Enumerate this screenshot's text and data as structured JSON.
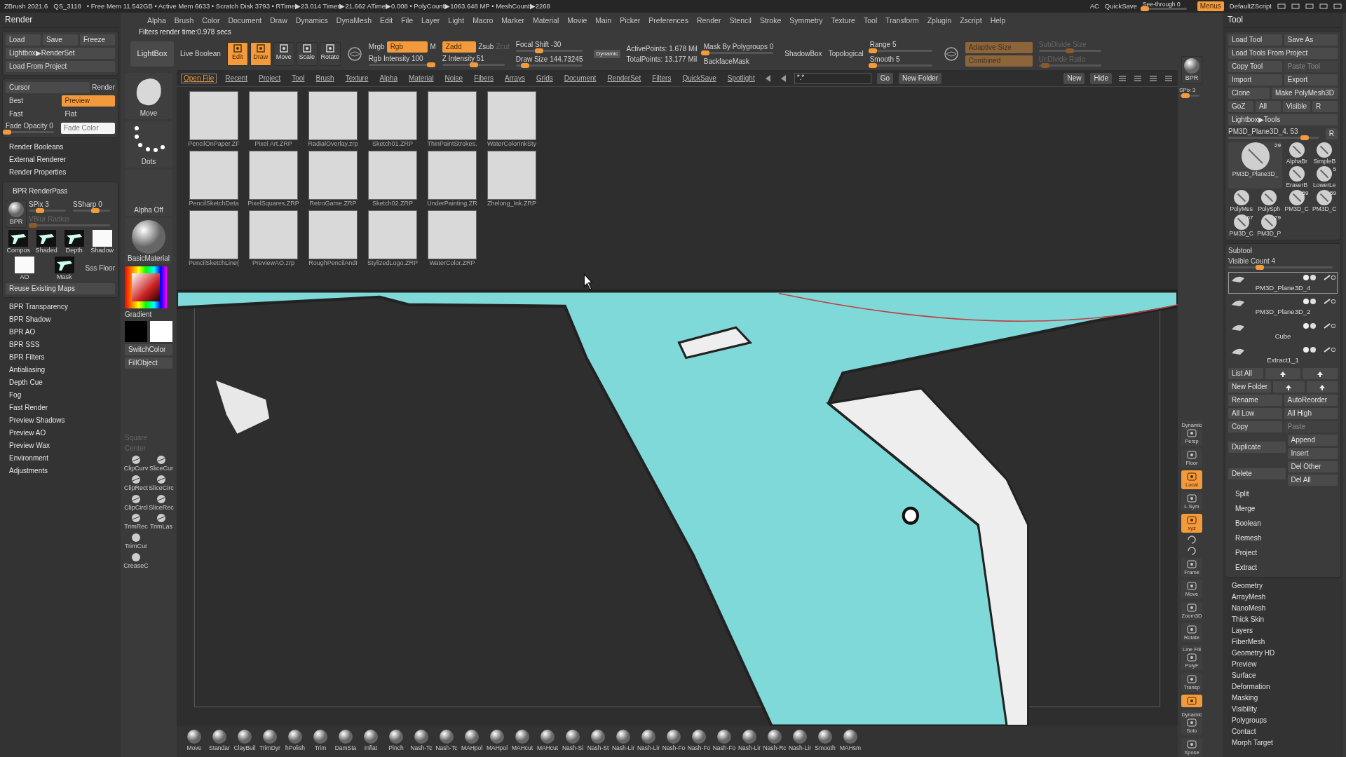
{
  "title_bar": {
    "app": "ZBrush 2021.6",
    "project": "QS_3118",
    "stats": "• Free Mem 11.542GB • Active Mem 6633 • Scratch Disk 3793 • RTime▶23.014 Timer▶21.662 ATime▶0.008 • PolyCount▶1063.648 MP • MeshCount▶2268",
    "items": [
      {
        "kind": "text",
        "label": "AC"
      },
      {
        "kind": "text",
        "label": "QuickSave"
      },
      {
        "kind": "slider",
        "label": "See-through 0",
        "level": 0.05
      },
      {
        "kind": "button",
        "label": "Menus",
        "on": true
      },
      {
        "kind": "text",
        "label": "DefaultZScript"
      }
    ]
  },
  "menus": [
    "Alpha",
    "Brush",
    "Color",
    "Document",
    "Draw",
    "Dynamics",
    "DynaMesh",
    "Edit",
    "File",
    "Layer",
    "Light",
    "Macro",
    "Marker",
    "Material",
    "Movie",
    "Main",
    "Picker",
    "Preferences",
    "Render",
    "Stencil",
    "Stroke",
    "Symmetry",
    "Texture",
    "Tool",
    "Transform",
    "Zplugin",
    "Zscript",
    "Help"
  ],
  "info": "Filters render time:0.978 secs",
  "toolbar": [
    [
      [
        {
          "kind": "button",
          "label": "LightBox"
        }
      ]
    ],
    [
      [
        {
          "kind": "text",
          "label": "Live Boolean"
        }
      ]
    ],
    [
      [
        {
          "kind": "tool",
          "label": "Edit",
          "on": true
        },
        {
          "kind": "tool",
          "label": "Draw",
          "on": true
        },
        {
          "kind": "tool",
          "label": "Move",
          "on": false
        },
        {
          "kind": "tool",
          "label": "Scale",
          "on": false
        },
        {
          "kind": "tool",
          "label": "Rotate",
          "on": false
        }
      ]
    ],
    [
      [
        {
          "kind": "globe"
        }
      ]
    ],
    [
      [
        {
          "kind": "text",
          "label": "Mrgb"
        },
        {
          "kind": "button",
          "label": "Rgb",
          "on": true
        },
        {
          "kind": "text",
          "label": "M"
        }
      ],
      [
        {
          "kind": "slider",
          "label": "Rgb Intensity 100",
          "level": 1
        }
      ]
    ],
    [
      [
        {
          "kind": "button",
          "label": "Zadd",
          "on": true
        },
        {
          "kind": "text",
          "label": "Zsub"
        },
        {
          "kind": "text",
          "label": "Zcut",
          "disabled": true
        }
      ],
      [
        {
          "kind": "slider",
          "label": "Z Intensity 51",
          "level": 0.51
        }
      ]
    ],
    [
      [
        {
          "kind": "slider",
          "label": "Focal Shift -30",
          "level": 0.35
        }
      ],
      [
        {
          "kind": "slider",
          "label": "Draw Size 144.73245",
          "level": 0.14
        }
      ]
    ],
    [
      [
        {
          "kind": "tag",
          "label": "Dynamic"
        }
      ]
    ],
    [
      [
        {
          "kind": "text",
          "label": "ActivePoints: 1.678 Mil"
        }
      ],
      [
        {
          "kind": "text",
          "label": "TotalPoints: 13.177 Mil"
        }
      ]
    ],
    [
      [
        {
          "kind": "slider",
          "label": "Mask By Polygroups 0",
          "level": 0.02
        }
      ],
      [
        {
          "kind": "text",
          "label": "BackfaceMask"
        }
      ]
    ],
    [
      [
        {
          "kind": "text",
          "label": "ShadowBox"
        }
      ]
    ],
    [
      [
        {
          "kind": "text",
          "label": "Topological"
        }
      ]
    ],
    [
      [
        {
          "kind": "slider",
          "label": "Range 5",
          "level": 0.05
        }
      ],
      [
        {
          "kind": "slider",
          "label": "Smooth 5",
          "level": 0.05
        }
      ]
    ],
    [
      [
        {
          "kind": "globe"
        }
      ]
    ],
    [
      [
        {
          "kind": "button",
          "label": "Adaptive Size",
          "on": true,
          "disabled": true
        }
      ],
      [
        {
          "kind": "button",
          "label": "Combined",
          "on": true,
          "disabled": true
        }
      ]
    ],
    [
      [
        {
          "kind": "slider",
          "label": "SubDivide Size",
          "level": 0.5,
          "disabled": true
        }
      ],
      [
        {
          "kind": "slider",
          "label": "UnDivide Ratio",
          "level": 0.1,
          "disabled": true
        }
      ]
    ]
  ],
  "left_panel": {
    "title": "Render",
    "blocks": [
      {
        "kind": "box",
        "rows": [
          [
            {
              "kind": "button",
              "label": "Load"
            },
            {
              "kind": "button",
              "label": "Save"
            },
            {
              "kind": "button",
              "label": "Freeze"
            }
          ],
          [
            {
              "kind": "button",
              "label": "Lightbox▶RenderSet"
            }
          ],
          [
            {
              "kind": "button",
              "label": "Load From Project"
            }
          ]
        ]
      },
      {
        "kind": "box",
        "rows": [
          [
            {
              "kind": "button",
              "label": "Cursor"
            },
            {
              "kind": "text",
              "label": "Render"
            }
          ],
          [
            {
              "kind": "option",
              "label": "Best",
              "selected": false
            },
            {
              "kind": "option",
              "label": "Preview",
              "selected": true
            }
          ],
          [
            {
              "kind": "option",
              "label": "Fast",
              "selected": false
            },
            {
              "kind": "option",
              "label": "Flat",
              "selected": false
            }
          ],
          [
            {
              "kind": "slider",
              "label": "Fade Opacity 0",
              "level": 0.03
            },
            {
              "kind": "field",
              "label": "Fade Color"
            }
          ]
        ]
      },
      {
        "kind": "heading",
        "label": "Render Booleans"
      },
      {
        "kind": "heading",
        "label": "External Renderer"
      },
      {
        "kind": "heading",
        "label": "Render Properties"
      },
      {
        "kind": "box",
        "rows": [
          [
            {
              "kind": "heading",
              "label": "BPR RenderPass"
            }
          ],
          [
            {
              "kind": "sphere",
              "label": "BPR"
            },
            {
              "kind": "stack",
              "rows": [
                [
                  {
                    "kind": "slider",
                    "label": "SPix 3",
                    "level": 0.3
                  },
                  {
                    "kind": "slider",
                    "label": "SSharp 0",
                    "level": 0.6
                  }
                ],
                [
                  {
                    "kind": "slider",
                    "label": "VBlur Radius",
                    "level": 0.05,
                    "disabled": true
                  }
                ]
              ]
            }
          ],
          [
            {
              "kind": "map",
              "label": "Compos"
            },
            {
              "kind": "map",
              "label": "Shaded"
            },
            {
              "kind": "map",
              "label": "Depth"
            },
            {
              "kind": "whitemap",
              "label": "Shadow"
            }
          ],
          [
            {
              "kind": "whitemap",
              "label": "AO"
            },
            {
              "kind": "map",
              "label": "Mask"
            },
            {
              "kind": "text",
              "label": "Sss"
            },
            {
              "kind": "text",
              "label": "Floor"
            }
          ],
          [
            {
              "kind": "button",
              "label": "Reuse Existing Maps"
            }
          ]
        ]
      },
      {
        "kind": "heading",
        "label": "BPR Transparency"
      },
      {
        "kind": "heading",
        "label": "BPR Shadow"
      },
      {
        "kind": "heading",
        "label": "BPR AO"
      },
      {
        "kind": "heading",
        "label": "BPR SSS"
      },
      {
        "kind": "heading",
        "label": "BPR Filters"
      },
      {
        "kind": "heading",
        "label": "Antialiasing"
      },
      {
        "kind": "heading",
        "label": "Depth Cue"
      },
      {
        "kind": "heading",
        "label": "Fog"
      },
      {
        "kind": "heading",
        "label": "Fast Render"
      },
      {
        "kind": "heading",
        "label": "Preview Shadows"
      },
      {
        "kind": "heading",
        "label": "Preview AO"
      },
      {
        "kind": "heading",
        "label": "Preview Wax"
      },
      {
        "kind": "heading",
        "label": "Environment"
      },
      {
        "kind": "heading",
        "label": "Adjustments"
      }
    ]
  },
  "left_shelf": [
    {
      "kind": "brush",
      "label": "Move"
    },
    {
      "kind": "stroke",
      "label": "Dots"
    },
    {
      "kind": "alpha",
      "label": "Alpha Off"
    },
    {
      "kind": "material",
      "label": "BasicMaterial"
    },
    {
      "kind": "picker"
    },
    {
      "kind": "text",
      "label": "Gradient"
    },
    {
      "kind": "swatches"
    },
    {
      "kind": "button",
      "label": "SwitchColor"
    },
    {
      "kind": "button",
      "label": "FillObject"
    },
    {
      "kind": "faint",
      "label": "Square"
    },
    {
      "kind": "faint",
      "label": "Center"
    },
    {
      "kind": "pair",
      "items": [
        "ClipCurv",
        "SliceCur"
      ]
    },
    {
      "kind": "pair",
      "items": [
        "ClipRect",
        "SliceCirc"
      ]
    },
    {
      "kind": "pair",
      "items": [
        "ClipCircl",
        "SliceRec"
      ]
    },
    {
      "kind": "pair",
      "items": [
        "TrimRec",
        "TrimLas"
      ]
    },
    {
      "kind": "tool",
      "label": "TrimCur"
    },
    {
      "kind": "tool",
      "label": "CreaseC"
    }
  ],
  "lightbox": {
    "tabs": [
      {
        "label": "Open File",
        "selected": true
      },
      {
        "label": "Recent",
        "selected": false
      },
      {
        "label": "Project",
        "selected": false
      },
      {
        "label": "Tool",
        "selected": false
      },
      {
        "label": "Brush",
        "selected": false
      },
      {
        "label": "Texture",
        "selected": false
      },
      {
        "label": "Alpha",
        "selected": false
      },
      {
        "label": "Material",
        "selected": false
      },
      {
        "label": "Noise",
        "selected": false
      },
      {
        "label": "Fibers",
        "selected": false
      },
      {
        "label": "Arrays",
        "selected": false
      },
      {
        "label": "Grids",
        "selected": false
      },
      {
        "label": "Document",
        "selected": false
      },
      {
        "label": "RenderSet",
        "selected": false
      },
      {
        "label": "Filters",
        "selected": false
      },
      {
        "label": "QuickSave",
        "selected": false
      },
      {
        "label": "Spotlight",
        "selected": false
      }
    ],
    "filter": "*.*",
    "buttons": [
      "Go",
      "New Folder"
    ],
    "right_buttons": [
      "New",
      "Hide"
    ],
    "files": [
      "PencilOnPaper.ZF",
      "Pixel Art.ZRP",
      "RadialOverlay.zrp",
      "Sketch01.ZRP",
      "ThinPaintStrokes.",
      "WaterColorInkSty",
      "PencilSketchDeta",
      "PixelSquares.ZRP",
      "RetroGame.ZRP",
      "Sketch02.ZRP",
      "UnderPainting.ZR",
      "Zhelong_Ink.ZRP",
      "PencilSketchLine(",
      "PreviewAO.zrp",
      "RoughPencilAndI",
      "StylizedLogo.ZRP",
      "WaterColor.ZRP"
    ]
  },
  "right_shelf": [
    {
      "kind": "sphere",
      "label": "BPR"
    },
    {
      "kind": "slider",
      "label": "SPix 3",
      "level": 0.3
    },
    {
      "kind": "shelf",
      "sub": "Dynamic",
      "label": "Persp"
    },
    {
      "kind": "shelf",
      "label": "Floor"
    },
    {
      "kind": "shelf",
      "label": "Local",
      "on": true
    },
    {
      "kind": "shelf",
      "label": "L.Sym"
    },
    {
      "kind": "shelf",
      "label": "xyz",
      "on": true
    },
    {
      "kind": "glyph"
    },
    {
      "kind": "glyph"
    },
    {
      "kind": "shelf",
      "label": "Frame"
    },
    {
      "kind": "shelf",
      "label": "Move"
    },
    {
      "kind": "shelf",
      "label": "Zoom3D"
    },
    {
      "kind": "shelf",
      "label": "Rotate"
    },
    {
      "kind": "shelf",
      "sub": "Line Fill",
      "label": "PolyF"
    },
    {
      "kind": "shelf",
      "label": "Transp"
    },
    {
      "kind": "shelf",
      "on": true
    },
    {
      "kind": "shelf",
      "sub": "Dynamic",
      "label": "Solo"
    },
    {
      "kind": "shelf",
      "label": "Xpose"
    }
  ],
  "tool_panel": {
    "title": "Tool",
    "rows": [
      [
        {
          "kind": "button",
          "label": "Load Tool"
        },
        {
          "kind": "button",
          "label": "Save As"
        }
      ],
      [
        {
          "kind": "button",
          "label": "Load Tools From Project"
        }
      ],
      [
        {
          "kind": "button",
          "label": "Copy Tool"
        },
        {
          "kind": "button",
          "label": "Paste Tool",
          "disabled": true
        }
      ],
      [
        {
          "kind": "button",
          "label": "Import"
        },
        {
          "kind": "button",
          "label": "Export"
        }
      ],
      [
        {
          "kind": "button",
          "label": "Clone"
        },
        {
          "kind": "button",
          "label": "Make PolyMesh3D"
        }
      ],
      [
        {
          "kind": "button",
          "label": "GoZ"
        },
        {
          "kind": "button",
          "label": "All"
        },
        {
          "kind": "button",
          "label": "Visible"
        },
        {
          "kind": "button",
          "label": "R"
        }
      ],
      [
        {
          "kind": "button",
          "label": "Lightbox▶Tools"
        }
      ],
      [
        {
          "kind": "slider",
          "label": "PM3D_Plane3D_4. 53",
          "level": 0.85
        },
        {
          "kind": "button",
          "label": "R"
        }
      ]
    ],
    "tools": [
      {
        "kind": "large",
        "label": "PM3D_Plane3D_",
        "count": "29"
      },
      {
        "kind": "small",
        "label": "AlphaBr"
      },
      {
        "kind": "small",
        "label": "SimpleB"
      },
      {
        "kind": "small",
        "label": "EraserB"
      },
      {
        "kind": "small",
        "label": "LowerLe",
        "count": "5"
      },
      {
        "kind": "small",
        "label": "PolyMes"
      },
      {
        "kind": "small",
        "label": "PolySph"
      },
      {
        "kind": "small",
        "label": "PM3D_C",
        "count": "59"
      },
      {
        "kind": "small",
        "label": "PM3D_C",
        "count": "59"
      },
      {
        "kind": "small",
        "label": "PM3D_C",
        "count": "67"
      },
      {
        "kind": "small",
        "label": "PM3D_P",
        "count": "29"
      }
    ],
    "subtool": {
      "title": "Subtool",
      "visible": {
        "label": "Visible Count 4",
        "level": 0.3
      },
      "items": [
        {
          "name": "PM3D_Plane3D_4",
          "selected": true
        },
        {
          "name": "PM3D_Plane3D_2",
          "selected": false
        },
        {
          "name": "Cube",
          "selected": false
        },
        {
          "name": "Extract1_1",
          "selected": false
        }
      ],
      "rows": [
        [
          {
            "kind": "button",
            "label": "List All"
          },
          {
            "kind": "arrow"
          },
          {
            "kind": "arrow"
          }
        ],
        [
          {
            "kind": "button",
            "label": "New Folder"
          },
          {
            "kind": "arrow"
          },
          {
            "kind": "arrow"
          }
        ],
        [
          {
            "kind": "button",
            "label": "Rename"
          },
          {
            "kind": "button",
            "label": "AutoReorder"
          }
        ],
        [
          {
            "kind": "button",
            "label": "All Low"
          },
          {
            "kind": "button",
            "label": "All High"
          }
        ],
        [
          {
            "kind": "button",
            "label": "Copy"
          },
          {
            "kind": "button",
            "label": "Paste",
            "disabled": true
          }
        ],
        [
          {
            "kind": "button",
            "label": "Duplicate"
          },
          {
            "kind": "stack",
            "rows": [
              [
                {
                  "kind": "button",
                  "label": "Append"
                }
              ],
              [
                {
                  "kind": "button",
                  "label": "Insert"
                }
              ]
            ]
          }
        ],
        [
          {
            "kind": "button",
            "label": "Delete"
          },
          {
            "kind": "stack",
            "rows": [
              [
                {
                  "kind": "button",
                  "label": "Del Other"
                }
              ],
              [
                {
                  "kind": "button",
                  "label": "Del All"
                }
              ]
            ]
          }
        ],
        [
          {
            "kind": "heading",
            "label": "Split"
          }
        ],
        [
          {
            "kind": "heading",
            "label": "Merge"
          }
        ],
        [
          {
            "kind": "heading",
            "label": "Boolean"
          }
        ],
        [
          {
            "kind": "heading",
            "label": "Remesh"
          }
        ],
        [
          {
            "kind": "heading",
            "label": "Project"
          }
        ],
        [
          {
            "kind": "heading",
            "label": "Extract"
          }
        ]
      ]
    },
    "sections": [
      "Geometry",
      "ArrayMesh",
      "NanoMesh",
      "Thick Skin",
      "Layers",
      "FiberMesh",
      "Geometry HD",
      "Preview",
      "Surface",
      "Deformation",
      "Masking",
      "Visibility",
      "Polygroups",
      "Contact",
      "Morph Target"
    ]
  },
  "brush_shelf": [
    "Move",
    "Standar",
    "ClayBuil",
    "TrimDyr",
    "hPolish",
    "Trim",
    "DamSta",
    "Inflat",
    "Pinch",
    "Nash-Tc",
    "Nash-Tc",
    "MAHpol",
    "MAHpol",
    "MAHcut",
    "MAHcut",
    "Nash-Si",
    "Nash-St",
    "Nash-Lir",
    "Nash-Lir",
    "Nash-Fo",
    "Nash-Fo",
    "Nash-Fo",
    "Nash-Lir",
    "Nash-Rc",
    "Nash-Lir",
    "Smooth",
    "MAHsm"
  ]
}
